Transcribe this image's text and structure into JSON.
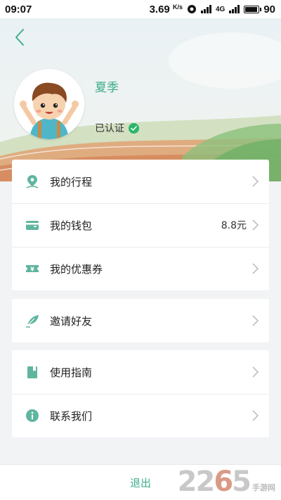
{
  "status_bar": {
    "time": "09:07",
    "speed": "3.69",
    "speed_unit": "K/s",
    "network": "4G",
    "battery": "90"
  },
  "profile": {
    "username": "夏季",
    "verified_label": "已认证"
  },
  "menu_groups": [
    [
      {
        "label": "我的行程",
        "icon": "location-pin-icon",
        "value": ""
      },
      {
        "label": "我的钱包",
        "icon": "wallet-icon",
        "value": "8.8元"
      },
      {
        "label": "我的优惠券",
        "icon": "coupon-icon",
        "value": ""
      }
    ],
    [
      {
        "label": "邀请好友",
        "icon": "feather-icon",
        "value": ""
      }
    ],
    [
      {
        "label": "使用指南",
        "icon": "guide-book-icon",
        "value": ""
      },
      {
        "label": "联系我们",
        "icon": "info-icon",
        "value": ""
      }
    ]
  ],
  "logout_label": "退出",
  "watermark": {
    "number": "2265",
    "site": "手游网"
  },
  "colors": {
    "accent": "#3fae8c",
    "verified": "#2bb56b",
    "icon_teal": "#5fb5a0"
  }
}
